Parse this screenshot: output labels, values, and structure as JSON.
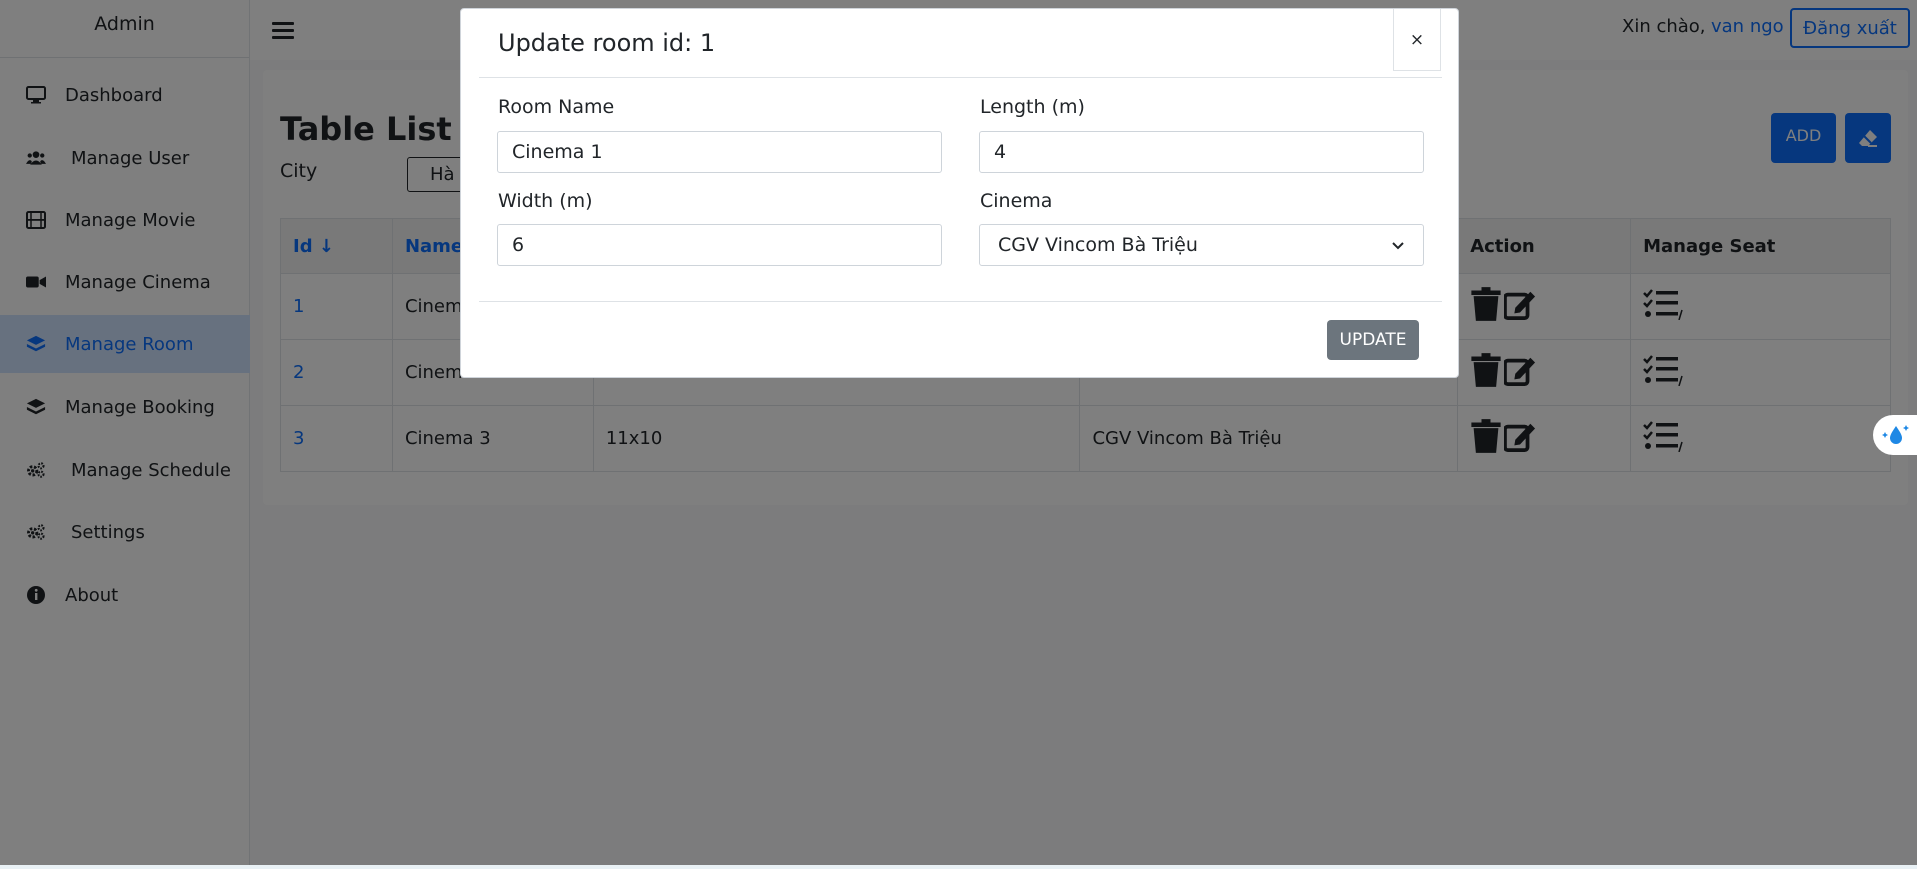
{
  "sidebar": {
    "brand": "Admin",
    "items": [
      {
        "label": "Dashboard",
        "icon": "monitor-icon"
      },
      {
        "label": "Manage User",
        "icon": "users-icon"
      },
      {
        "label": "Manage Movie",
        "icon": "film-icon"
      },
      {
        "label": "Manage Cinema",
        "icon": "video-camera-icon"
      },
      {
        "label": "Manage Room",
        "icon": "layers-icon",
        "active": true
      },
      {
        "label": "Manage Booking",
        "icon": "layers-icon"
      },
      {
        "label": "Manage Schedule",
        "icon": "gears-icon"
      },
      {
        "label": "Settings",
        "icon": "gears-icon"
      },
      {
        "label": "About",
        "icon": "info-icon"
      }
    ]
  },
  "topbar": {
    "greeting": "Xin chào,",
    "user": "van ngo",
    "logout_label": "Đăng xuất"
  },
  "page": {
    "title": "Table List Ro",
    "city_label": "City",
    "city_value": "Hà",
    "add_label": "ADD"
  },
  "table": {
    "headers": [
      "Id",
      "Name",
      "",
      "",
      "Action",
      "Manage Seat"
    ],
    "rows": [
      {
        "id": "1",
        "name": "Cinem",
        "size": "",
        "cinema": ""
      },
      {
        "id": "2",
        "name": "Cinem",
        "size": "",
        "cinema": ""
      },
      {
        "id": "3",
        "name": "Cinema 3",
        "size": "11x10",
        "cinema": "CGV Vincom Bà Triệu"
      }
    ]
  },
  "modal": {
    "title": "Update room id: 1",
    "close": "×",
    "room_name_label": "Room Name",
    "room_name_value": "Cinema 1",
    "length_label": "Length (m)",
    "length_value": "4",
    "width_label": "Width (m)",
    "width_value": "6",
    "cinema_label": "Cinema",
    "cinema_value": "CGV Vincom Bà Triệu",
    "update_label": "UPDATE"
  },
  "colors": {
    "primary": "#0d6efd",
    "secondary": "#6c757d",
    "active_nav_bg": "#cfe2ff"
  }
}
